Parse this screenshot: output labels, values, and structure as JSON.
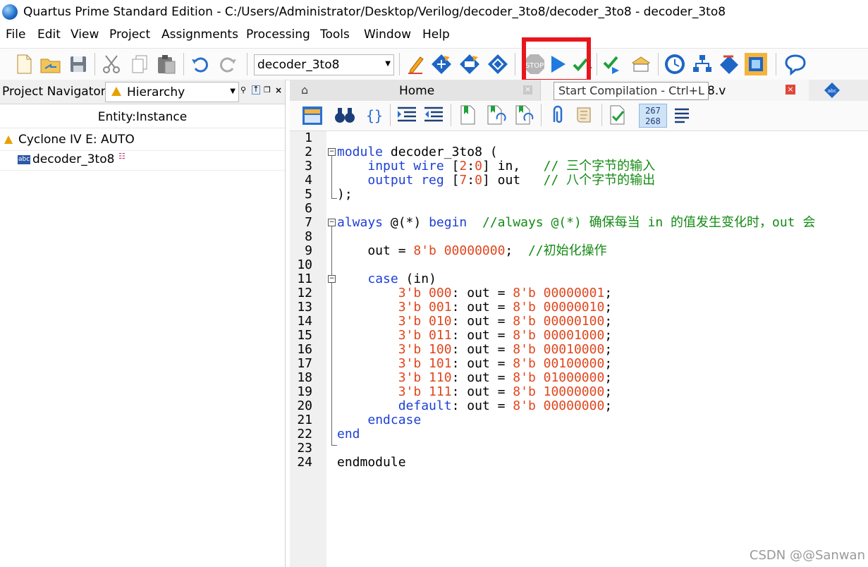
{
  "window": {
    "title": "Quartus Prime Standard Edition - C:/Users/Administrator/Desktop/Verilog/decoder_3to8/decoder_3to8 - decoder_3to8"
  },
  "menu": [
    "File",
    "Edit",
    "View",
    "Project",
    "Assignments",
    "Processing",
    "Tools",
    "Window",
    "Help"
  ],
  "toolbar": {
    "entity_value": "decoder_3to8",
    "stop_label": "STOP",
    "tooltip": "Start Compilation - Ctrl+L",
    "highlight_color": "#e8161c"
  },
  "navigator": {
    "title": "Project Navigator",
    "view_select": "Hierarchy",
    "column_header": "Entity:Instance",
    "device": "Cyclone IV E: AUTO",
    "top_entity": "decoder_3to8"
  },
  "tabs": {
    "home": "Home",
    "file_suffix": "8.v"
  },
  "editor_toolbar": {
    "line_nums_top": "267",
    "line_nums_bottom": "268"
  },
  "code": {
    "line_numbers": [
      "1",
      "2",
      "3",
      "4",
      "5",
      "6",
      "7",
      "8",
      "9",
      "10",
      "11",
      "12",
      "13",
      "14",
      "15",
      "16",
      "17",
      "18",
      "19",
      "20",
      "21",
      "22",
      "23",
      "24"
    ],
    "lines": [
      [],
      [
        {
          "t": "module",
          "c": "kw"
        },
        {
          "t": " decoder_3to8 ("
        }
      ],
      [
        {
          "t": "    "
        },
        {
          "t": "input wire",
          "c": "kw"
        },
        {
          "t": " ["
        },
        {
          "t": "2",
          "c": "nm"
        },
        {
          "t": ":"
        },
        {
          "t": "0",
          "c": "nm"
        },
        {
          "t": "] in,   "
        },
        {
          "t": "// 三个字节的输入",
          "c": "cm"
        }
      ],
      [
        {
          "t": "    "
        },
        {
          "t": "output reg",
          "c": "kw"
        },
        {
          "t": " ["
        },
        {
          "t": "7",
          "c": "nm"
        },
        {
          "t": ":"
        },
        {
          "t": "0",
          "c": "nm"
        },
        {
          "t": "] out   "
        },
        {
          "t": "// 八个字节的输出",
          "c": "cm"
        }
      ],
      [
        {
          "t": ");"
        }
      ],
      [],
      [
        {
          "t": "always",
          "c": "kw"
        },
        {
          "t": " @(*) "
        },
        {
          "t": "begin",
          "c": "kw"
        },
        {
          "t": "  "
        },
        {
          "t": "//always @(*) 确保每当 in 的值发生变化时，out 会",
          "c": "cm"
        }
      ],
      [],
      [
        {
          "t": "    out = "
        },
        {
          "t": "8'b 00000000",
          "c": "nm"
        },
        {
          "t": ";  "
        },
        {
          "t": "//初始化操作",
          "c": "cm"
        }
      ],
      [],
      [
        {
          "t": "    "
        },
        {
          "t": "case",
          "c": "kw"
        },
        {
          "t": " (in)"
        }
      ],
      [
        {
          "t": "        "
        },
        {
          "t": "3'b 000",
          "c": "nm"
        },
        {
          "t": ": out = "
        },
        {
          "t": "8'b 00000001",
          "c": "nm"
        },
        {
          "t": ";"
        }
      ],
      [
        {
          "t": "        "
        },
        {
          "t": "3'b 001",
          "c": "nm"
        },
        {
          "t": ": out = "
        },
        {
          "t": "8'b 00000010",
          "c": "nm"
        },
        {
          "t": ";"
        }
      ],
      [
        {
          "t": "        "
        },
        {
          "t": "3'b 010",
          "c": "nm"
        },
        {
          "t": ": out = "
        },
        {
          "t": "8'b 00000100",
          "c": "nm"
        },
        {
          "t": ";"
        }
      ],
      [
        {
          "t": "        "
        },
        {
          "t": "3'b 011",
          "c": "nm"
        },
        {
          "t": ": out = "
        },
        {
          "t": "8'b 00001000",
          "c": "nm"
        },
        {
          "t": ";"
        }
      ],
      [
        {
          "t": "        "
        },
        {
          "t": "3'b 100",
          "c": "nm"
        },
        {
          "t": ": out = "
        },
        {
          "t": "8'b 00010000",
          "c": "nm"
        },
        {
          "t": ";"
        }
      ],
      [
        {
          "t": "        "
        },
        {
          "t": "3'b 101",
          "c": "nm"
        },
        {
          "t": ": out = "
        },
        {
          "t": "8'b 00100000",
          "c": "nm"
        },
        {
          "t": ";"
        }
      ],
      [
        {
          "t": "        "
        },
        {
          "t": "3'b 110",
          "c": "nm"
        },
        {
          "t": ": out = "
        },
        {
          "t": "8'b 01000000",
          "c": "nm"
        },
        {
          "t": ";"
        }
      ],
      [
        {
          "t": "        "
        },
        {
          "t": "3'b 111",
          "c": "nm"
        },
        {
          "t": ": out = "
        },
        {
          "t": "8'b 10000000",
          "c": "nm"
        },
        {
          "t": ";"
        }
      ],
      [
        {
          "t": "        "
        },
        {
          "t": "default",
          "c": "kw"
        },
        {
          "t": ": out = "
        },
        {
          "t": "8'b 00000000",
          "c": "nm"
        },
        {
          "t": ";"
        }
      ],
      [
        {
          "t": "    "
        },
        {
          "t": "endcase",
          "c": "kw"
        }
      ],
      [
        {
          "t": "end",
          "c": "kw"
        }
      ],
      [],
      [
        {
          "t": "endmodule"
        }
      ]
    ]
  },
  "watermark": "CSDN @@Sanwan"
}
